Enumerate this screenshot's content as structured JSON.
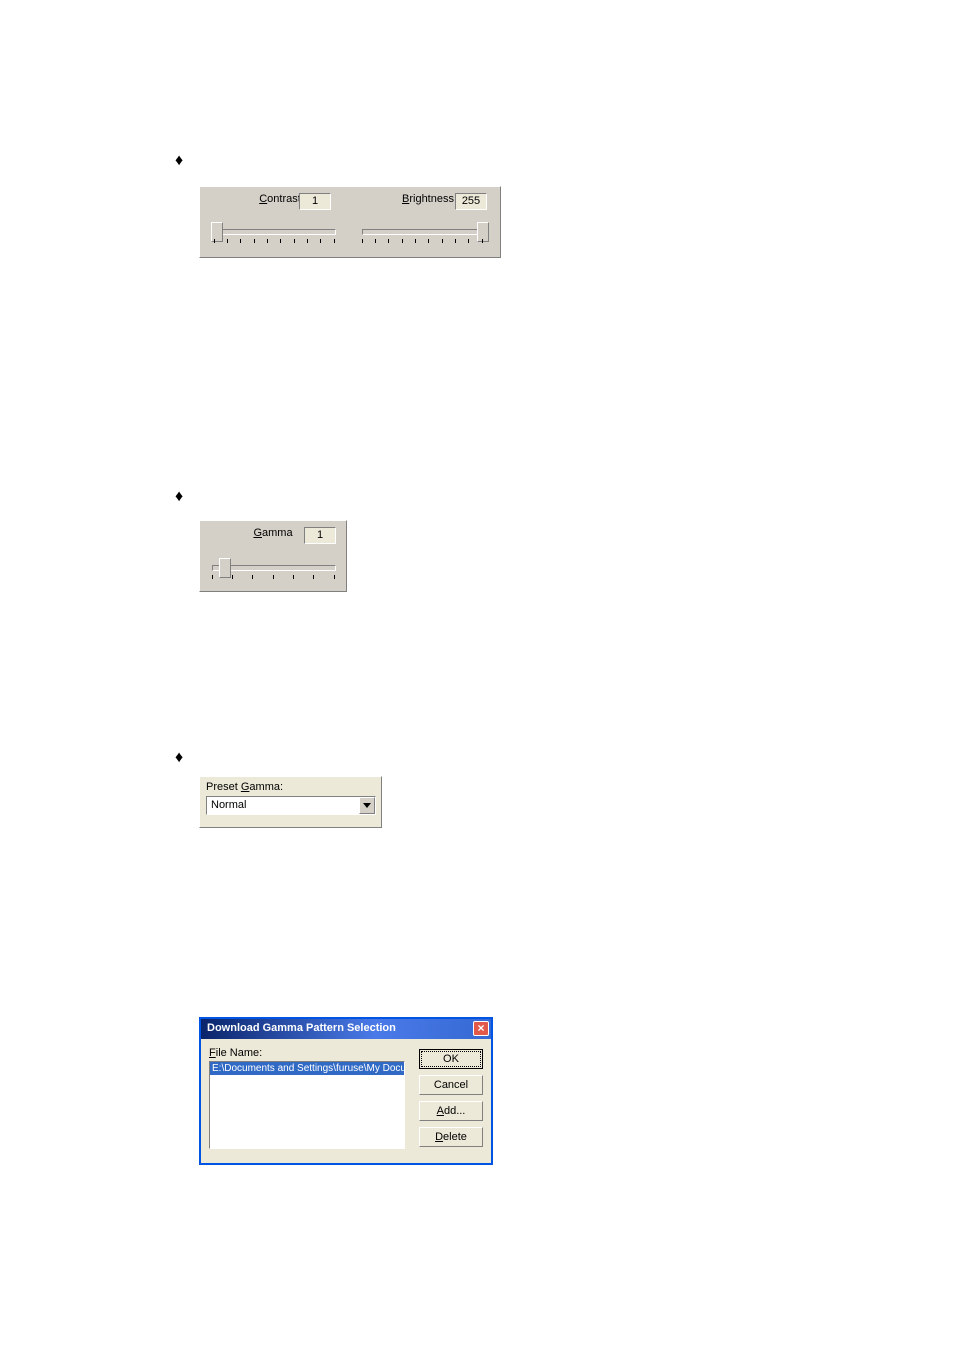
{
  "bullets": {
    "b1": "♦",
    "b2": "♦",
    "b3": "♦"
  },
  "cb": {
    "contrast_label_pre": "C",
    "contrast_label_rest": "ontrast",
    "contrast_value": "1",
    "brightness_label_pre": "B",
    "brightness_label_rest": "rightness",
    "brightness_value": "255"
  },
  "gamma": {
    "label_pre": "G",
    "label_rest": "amma",
    "value": "1"
  },
  "preset_gamma": {
    "label_full_pre": "Preset ",
    "label_u": "G",
    "label_post": "amma:",
    "selected": "Normal"
  },
  "dialog": {
    "title": "Download Gamma Pattern Selection",
    "file_name_label_pre": "F",
    "file_name_label_u": "i",
    "file_name_label_post": "le Name:",
    "items": [
      "E:\\Documents and Settings\\furuse\\My Documen"
    ],
    "buttons": {
      "ok": "OK",
      "cancel": "Cancel",
      "add_pre": "A",
      "add_u": "d",
      "add_post": "d...",
      "delete_pre": "D",
      "delete_u": "e",
      "delete_post": "lete"
    }
  }
}
